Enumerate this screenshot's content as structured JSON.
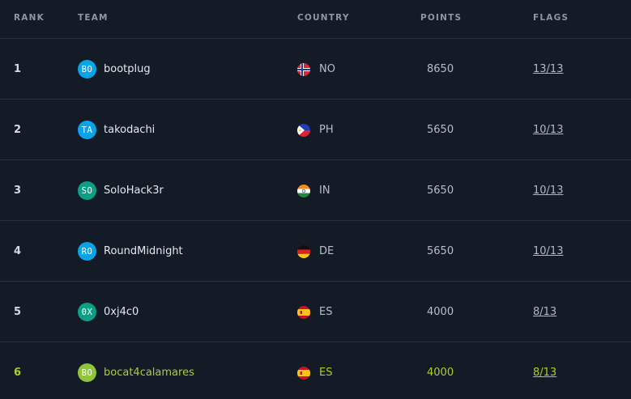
{
  "columns": {
    "rank": "RANK",
    "team": "TEAM",
    "country": "COUNTRY",
    "points": "POINTS",
    "flags": "FLAGS"
  },
  "rows": [
    {
      "rank": "1",
      "initials": "BO",
      "avatar_color": "#0aa3e8",
      "team": "bootplug",
      "flag_icon": "norway-flag-icon",
      "country": "NO",
      "points": "8650",
      "flags": "13/13",
      "highlight": false
    },
    {
      "rank": "2",
      "initials": "TA",
      "avatar_color": "#0aa3e8",
      "team": "takodachi",
      "flag_icon": "philippines-flag-icon",
      "country": "PH",
      "points": "5650",
      "flags": "10/13",
      "highlight": false
    },
    {
      "rank": "3",
      "initials": "SO",
      "avatar_color": "#0e9e86",
      "team": "SoloHack3r",
      "flag_icon": "india-flag-icon",
      "country": "IN",
      "points": "5650",
      "flags": "10/13",
      "highlight": false
    },
    {
      "rank": "4",
      "initials": "RO",
      "avatar_color": "#0aa3e8",
      "team": "RoundMidnight",
      "flag_icon": "germany-flag-icon",
      "country": "DE",
      "points": "5650",
      "flags": "10/13",
      "highlight": false
    },
    {
      "rank": "5",
      "initials": "0X",
      "avatar_color": "#0e9e86",
      "team": "0xj4c0",
      "flag_icon": "spain-flag-icon",
      "country": "ES",
      "points": "4000",
      "flags": "8/13",
      "highlight": false
    },
    {
      "rank": "6",
      "initials": "BO",
      "avatar_color": "#8fc53a",
      "team": "bocat4calamares",
      "flag_icon": "spain-flag-icon",
      "country": "ES",
      "points": "4000",
      "flags": "8/13",
      "highlight": true
    }
  ],
  "colors": {
    "background": "#131b26",
    "divider": "#28313d",
    "header_text": "#8c96a4",
    "highlight": "#a9d02a"
  }
}
